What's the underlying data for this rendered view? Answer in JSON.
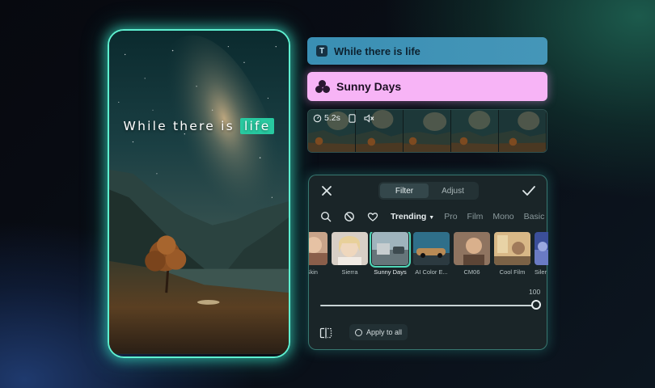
{
  "preview": {
    "overlay_text_prefix": "While there is",
    "overlay_text_highlight": "life"
  },
  "timeline": {
    "text_track_label": "While there is life",
    "text_track_icon": "T",
    "filter_track_label": "Sunny Days",
    "video_duration": "5.2s"
  },
  "panel": {
    "tabs": [
      {
        "label": "Filter",
        "active": true
      },
      {
        "label": "Adjust",
        "active": false
      }
    ],
    "categories": [
      {
        "label": "Trending",
        "active": true
      },
      {
        "label": "Pro",
        "active": false
      },
      {
        "label": "Film",
        "active": false
      },
      {
        "label": "Mono",
        "active": false
      },
      {
        "label": "Basic",
        "active": false
      }
    ],
    "filters": [
      {
        "label": "e Skin",
        "selected": false
      },
      {
        "label": "Sierra",
        "selected": false
      },
      {
        "label": "Sunny Days",
        "selected": true
      },
      {
        "label": "AI Color E...",
        "selected": false
      },
      {
        "label": "CM06",
        "selected": false
      },
      {
        "label": "Cool Film",
        "selected": false
      },
      {
        "label": "Siler",
        "selected": false
      }
    ],
    "intensity": "100",
    "intensity_fraction": 1.0,
    "apply_label": "Apply to all"
  },
  "colors": {
    "accent": "#5ef0d0",
    "highlight": "#28c9a0",
    "text_track": "#3a8fb4",
    "filter_track": "#f7b4f6",
    "panel_bg": "#1a2528"
  }
}
